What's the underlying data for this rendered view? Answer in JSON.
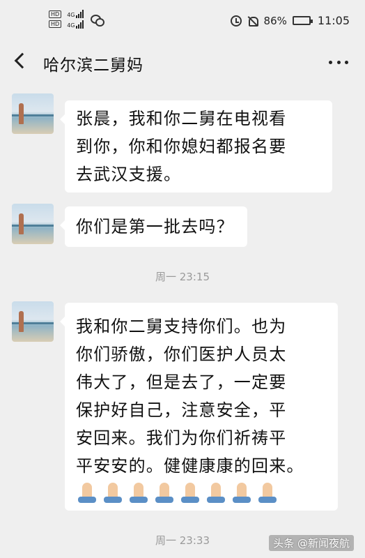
{
  "status_bar": {
    "sim1_tag": "HD",
    "sim1_gen": "4G",
    "sim2_tag": "HD",
    "sim2_gen": "4G",
    "battery_percent_text": "86%",
    "battery_level": 0.86,
    "time": "11:05",
    "icons": [
      "wechat-icon",
      "alarm-icon",
      "mute-icon",
      "battery-icon"
    ]
  },
  "header": {
    "title": "哈尔滨二舅妈"
  },
  "messages": [
    {
      "lines": [
        "张晨，我和你二舅在电视看",
        "到你，你和你媳妇都报名要",
        "去武汉支援。"
      ]
    },
    {
      "lines": [
        "你们是第一批去吗？"
      ]
    },
    {
      "lines": [
        "我和你二舅支持你们。也为",
        "你们骄傲，你们医护人员太",
        "伟大了，但是去了，一定要",
        "保护好自己，注意安全，平",
        "安回来。我们为你们祈祷平",
        "平安安的。健健康康的回来。"
      ],
      "emoji": "🙏🙏🙏🙏🙏🙏🙏🙏",
      "emoji_count": 8
    }
  ],
  "timestamps": [
    "周一 23:15",
    "周一 23:33"
  ],
  "watermark": "头条 @新闻夜航"
}
